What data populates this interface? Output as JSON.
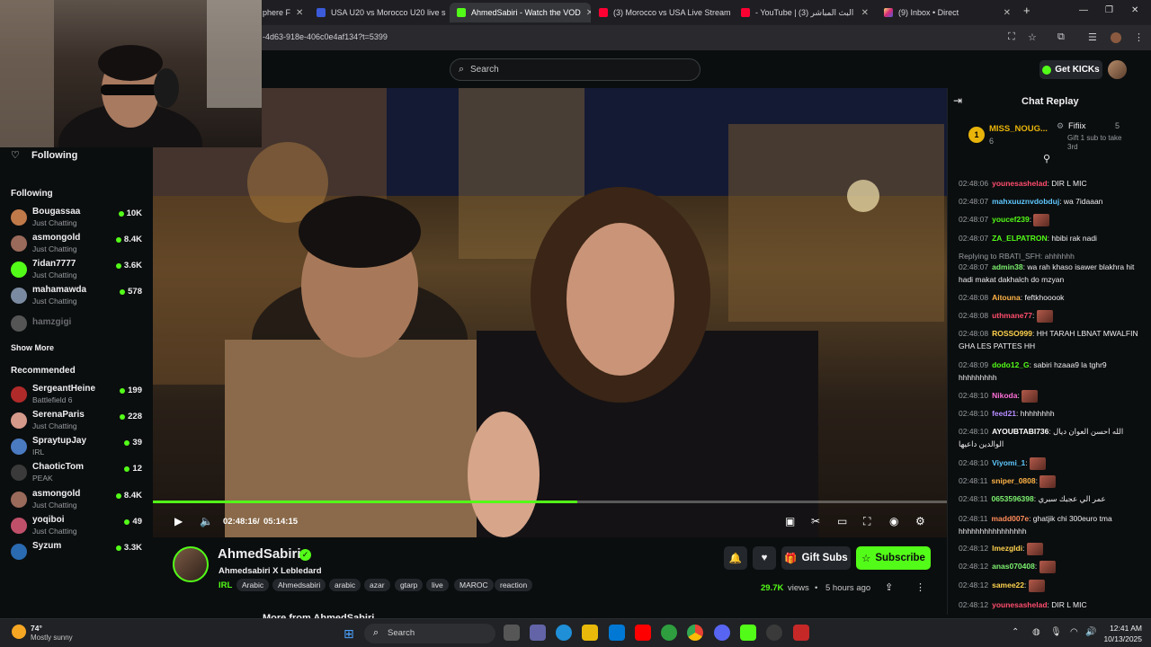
{
  "browser": {
    "tabs": [
      {
        "label": "phere F",
        "active": false
      },
      {
        "label": "USA U20 vs Morocco U20 live s",
        "active": false
      },
      {
        "label": "AhmedSabiri - Watch the VOD",
        "active": true
      },
      {
        "label": "(3) Morocco vs USA Live Stream",
        "active": false
      },
      {
        "label": "- YouTube | البث المباشر (3)",
        "active": false
      },
      {
        "label": "(9) Inbox • Direct",
        "active": false
      }
    ],
    "url": "-4d63-918e-406c0e4af134?t=5399"
  },
  "header": {
    "search_placeholder": "Search",
    "get_kicks_label": "Get KICKs"
  },
  "sidebar": {
    "following_title": "Following",
    "following_section": "Following",
    "following": [
      {
        "name": "Bougassaa",
        "category": "Just Chatting",
        "viewers": "10K"
      },
      {
        "name": "asmongold",
        "category": "Just Chatting",
        "viewers": "8.4K"
      },
      {
        "name": "7idan7777",
        "category": "Just Chatting",
        "viewers": "3.6K"
      },
      {
        "name": "mahamawda",
        "category": "Just Chatting",
        "viewers": "578"
      }
    ],
    "offline": {
      "name": "hamzgigi"
    },
    "show_more": "Show More",
    "recommended_section": "Recommended",
    "recommended": [
      {
        "name": "SergeantHeine",
        "category": "Battlefield 6",
        "viewers": "199"
      },
      {
        "name": "SerenaParis",
        "category": "Just Chatting",
        "viewers": "228"
      },
      {
        "name": "SpraytupJay",
        "category": "IRL",
        "viewers": "39"
      },
      {
        "name": "ChaoticTom",
        "category": "PEAK",
        "viewers": "12"
      },
      {
        "name": "asmongold",
        "category": "Just Chatting",
        "viewers": "8.4K"
      },
      {
        "name": "yoqiboi",
        "category": "Just Chatting",
        "viewers": "49"
      },
      {
        "name": "Syzum",
        "category": "",
        "viewers": "3.3K"
      }
    ]
  },
  "player": {
    "time_current": "02:48:16",
    "time_separator": "/",
    "time_total": "05:14:15",
    "progress": 0.535
  },
  "stream": {
    "streamer": "AhmedSabiri",
    "title": "Ahmedsabiri X Lebledard",
    "category": "IRL",
    "tags": [
      "Arabic",
      "Ahmedsabiri",
      "arabic",
      "azar",
      "gtarp",
      "live",
      "MAROC",
      "reaction"
    ],
    "views": "29.7K",
    "views_label": "views",
    "ago": "5 hours ago",
    "gift_subs_label": "Gift Subs",
    "subscribe_label": "Subscribe",
    "more_from": "More from AhmedSabiri"
  },
  "chat": {
    "title": "Chat Replay",
    "leaderboard": [
      {
        "rank": "1",
        "name": "MISS_NOUG...",
        "count": "6"
      },
      {
        "name": "Fifiix",
        "count": "5",
        "note": "Gift 1 sub to take 3rd"
      }
    ],
    "messages": [
      {
        "ts": "02:48:06",
        "user": "younesashelad",
        "color": "#ff4d6d",
        "text": "DIR L MIC"
      },
      {
        "ts": "02:48:07",
        "user": "mahxuuznvdobduj",
        "color": "#5ec8ff",
        "text": "wa 7idaaan"
      },
      {
        "ts": "02:48:07",
        "user": "youcef239",
        "color": "#53fc18",
        "text": "",
        "emote": true
      },
      {
        "ts": "02:48:07",
        "user": "ZA_ELPATRON",
        "color": "#53fc18",
        "text": "hbibi rak nadi"
      },
      {
        "ts": "",
        "user": "",
        "color": "#9a9ca0",
        "text": "Replying to RBATI_SFH: ahhhhhh",
        "reply": true
      },
      {
        "ts": "02:48:07",
        "user": "admin38",
        "color": "#7cf06f",
        "text": "wa rah khaso isawer blakhra hit hadi makat dakhalch do mzyan"
      },
      {
        "ts": "02:48:08",
        "user": "Aitouna",
        "color": "#ffb347",
        "text": "feftkhooook"
      },
      {
        "ts": "02:48:08",
        "user": "uthmane77",
        "color": "#ff4d6d",
        "text": "",
        "emote": true
      },
      {
        "ts": "02:48:08",
        "user": "ROSSO999",
        "color": "#ffd24d",
        "text": "HH TARAH LBNAT MWALFIN GHA LES PATTES HH"
      },
      {
        "ts": "02:48:09",
        "user": "dodo12_G",
        "color": "#53fc18",
        "text": "sabiri hzaaa9 la tghr9 hhhhhhhhh"
      },
      {
        "ts": "02:48:10",
        "user": "Nikoda",
        "color": "#ff6fd8",
        "text": "",
        "emote": true
      },
      {
        "ts": "02:48:10",
        "user": "feed21",
        "color": "#b58cff",
        "text": "hhhhhhhh"
      },
      {
        "ts": "02:48:10",
        "user": "AYOUBTABI736",
        "color": "#ffffff",
        "text": "الله احسن العوان ديال الوالدين داعيها"
      },
      {
        "ts": "02:48:10",
        "user": "Viyomi_1",
        "color": "#5ec8ff",
        "text": "",
        "emote": true
      },
      {
        "ts": "02:48:11",
        "user": "sniper_0808",
        "color": "#ffb347",
        "text": "",
        "emote": true
      },
      {
        "ts": "02:48:11",
        "user": "0653596398",
        "color": "#7cf06f",
        "text": "عمر الي عجبك سبري"
      },
      {
        "ts": "02:48:11",
        "user": "madd007e",
        "color": "#ff8c5a",
        "text": "ghatjik chi 300euro tma hhhhhhhhhhhhhhhh"
      },
      {
        "ts": "02:48:12",
        "user": "lmezgldi",
        "color": "#ffd24d",
        "text": "",
        "emote": true
      },
      {
        "ts": "02:48:12",
        "user": "anas070408",
        "color": "#7cf06f",
        "text": "",
        "emote": true
      },
      {
        "ts": "02:48:12",
        "user": "samee22",
        "color": "#ffd24d",
        "text": "",
        "emote": true
      },
      {
        "ts": "02:48:12",
        "user": "younesashelad",
        "color": "#ff4d6d",
        "text": "DIR L MIC"
      }
    ]
  },
  "taskbar": {
    "search_label": "Search",
    "time": "12:41 AM",
    "date": "10/13/2025",
    "weather": "Mostly sunny",
    "temp": "74°"
  },
  "colors": {
    "accent": "#53fc18",
    "bg": "#0b0e0f"
  }
}
